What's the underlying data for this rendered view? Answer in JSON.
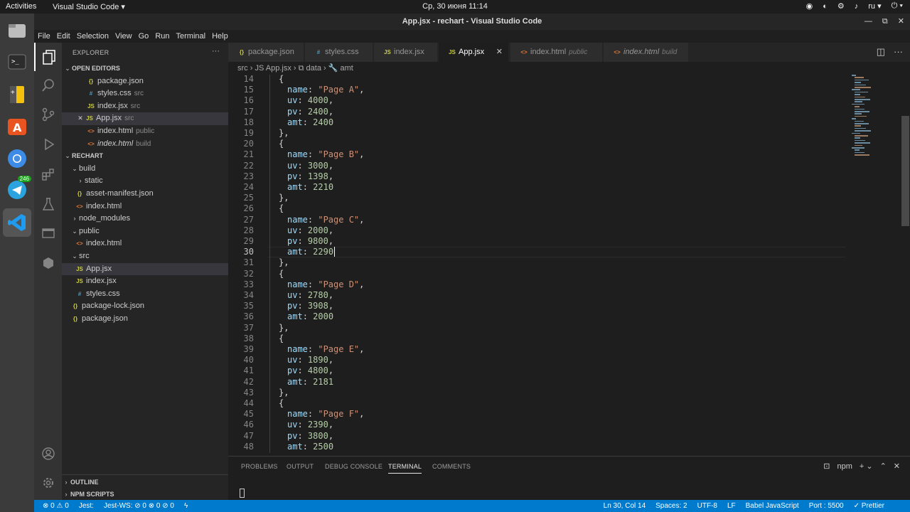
{
  "os": {
    "activities": "Activities",
    "app_menu": "Visual Studio Code ▾",
    "clock": "Ср, 30 июня  11:14",
    "lang": "ru ▾",
    "dock_badge": "246"
  },
  "window": {
    "title": "App.jsx - rechart - Visual Studio Code"
  },
  "menu": [
    "File",
    "Edit",
    "Selection",
    "View",
    "Go",
    "Run",
    "Terminal",
    "Help"
  ],
  "explorer": {
    "title": "EXPLORER",
    "open_editors": {
      "header": "OPEN EDITORS",
      "items": [
        {
          "icon": "{}",
          "cls": "json",
          "name": "package.json",
          "desc": ""
        },
        {
          "icon": "#",
          "cls": "css",
          "name": "styles.css",
          "desc": "src"
        },
        {
          "icon": "JS",
          "cls": "js",
          "name": "index.jsx",
          "desc": "src"
        },
        {
          "icon": "JS",
          "cls": "js",
          "name": "App.jsx",
          "desc": "src"
        },
        {
          "icon": "<>",
          "cls": "html",
          "name": "index.html",
          "desc": "public"
        },
        {
          "icon": "<>",
          "cls": "html",
          "name": "index.html",
          "desc": "build"
        }
      ]
    },
    "project": {
      "header": "RECHART",
      "items": [
        {
          "chev": "⌄",
          "name": "build"
        },
        {
          "chev": "›",
          "name": "static"
        },
        {
          "icon": "{}",
          "cls": "json",
          "name": "asset-manifest.json"
        },
        {
          "icon": "<>",
          "cls": "html",
          "name": "index.html"
        },
        {
          "chev": "›",
          "name": "node_modules"
        },
        {
          "chev": "⌄",
          "name": "public"
        },
        {
          "icon": "<>",
          "cls": "html",
          "name": "index.html"
        },
        {
          "chev": "⌄",
          "name": "src"
        },
        {
          "icon": "JS",
          "cls": "js",
          "name": "App.jsx"
        },
        {
          "icon": "JS",
          "cls": "js",
          "name": "index.jsx"
        },
        {
          "icon": "#",
          "cls": "css",
          "name": "styles.css"
        },
        {
          "icon": "{}",
          "cls": "json",
          "name": "package-lock.json"
        },
        {
          "icon": "{}",
          "cls": "json",
          "name": "package.json"
        }
      ]
    },
    "outline": "OUTLINE",
    "npm": "NPM SCRIPTS"
  },
  "tabs": [
    {
      "icon": "{}",
      "cls": "json",
      "name": "package.json",
      "desc": ""
    },
    {
      "icon": "#",
      "cls": "css",
      "name": "styles.css",
      "desc": ""
    },
    {
      "icon": "JS",
      "cls": "js",
      "name": "index.jsx",
      "desc": ""
    },
    {
      "icon": "JS",
      "cls": "js",
      "name": "App.jsx",
      "desc": ""
    },
    {
      "icon": "<>",
      "cls": "html",
      "name": "index.html",
      "desc": "public"
    },
    {
      "icon": "<>",
      "cls": "html",
      "name": "index.html",
      "desc": "build"
    }
  ],
  "breadcrumb": [
    "src",
    "App.jsx",
    "data",
    "amt"
  ],
  "code": [
    {
      "n": 14,
      "t": [
        [
          "p",
          "{"
        ]
      ]
    },
    {
      "n": 15,
      "t": [
        [
          "k",
          "name"
        ],
        [
          "p",
          ": "
        ],
        [
          "s",
          "\"Page A\""
        ],
        [
          "p",
          ","
        ]
      ]
    },
    {
      "n": 16,
      "t": [
        [
          "k",
          "uv"
        ],
        [
          "p",
          ": "
        ],
        [
          "n",
          "4000"
        ],
        [
          "p",
          ","
        ]
      ]
    },
    {
      "n": 17,
      "t": [
        [
          "k",
          "pv"
        ],
        [
          "p",
          ": "
        ],
        [
          "n",
          "2400"
        ],
        [
          "p",
          ","
        ]
      ]
    },
    {
      "n": 18,
      "t": [
        [
          "k",
          "amt"
        ],
        [
          "p",
          ": "
        ],
        [
          "n",
          "2400"
        ]
      ]
    },
    {
      "n": 19,
      "t": [
        [
          "p",
          "},"
        ]
      ]
    },
    {
      "n": 20,
      "t": [
        [
          "p",
          "{"
        ]
      ]
    },
    {
      "n": 21,
      "t": [
        [
          "k",
          "name"
        ],
        [
          "p",
          ": "
        ],
        [
          "s",
          "\"Page B\""
        ],
        [
          "p",
          ","
        ]
      ]
    },
    {
      "n": 22,
      "t": [
        [
          "k",
          "uv"
        ],
        [
          "p",
          ": "
        ],
        [
          "n",
          "3000"
        ],
        [
          "p",
          ","
        ]
      ]
    },
    {
      "n": 23,
      "t": [
        [
          "k",
          "pv"
        ],
        [
          "p",
          ": "
        ],
        [
          "n",
          "1398"
        ],
        [
          "p",
          ","
        ]
      ]
    },
    {
      "n": 24,
      "t": [
        [
          "k",
          "amt"
        ],
        [
          "p",
          ": "
        ],
        [
          "n",
          "2210"
        ]
      ]
    },
    {
      "n": 25,
      "t": [
        [
          "p",
          "},"
        ]
      ]
    },
    {
      "n": 26,
      "t": [
        [
          "p",
          "{"
        ]
      ]
    },
    {
      "n": 27,
      "t": [
        [
          "k",
          "name"
        ],
        [
          "p",
          ": "
        ],
        [
          "s",
          "\"Page C\""
        ],
        [
          "p",
          ","
        ]
      ]
    },
    {
      "n": 28,
      "t": [
        [
          "k",
          "uv"
        ],
        [
          "p",
          ": "
        ],
        [
          "n",
          "2000"
        ],
        [
          "p",
          ","
        ]
      ]
    },
    {
      "n": 29,
      "t": [
        [
          "k",
          "pv"
        ],
        [
          "p",
          ": "
        ],
        [
          "n",
          "9800"
        ],
        [
          "p",
          ","
        ]
      ]
    },
    {
      "n": 30,
      "t": [
        [
          "k",
          "amt"
        ],
        [
          "p",
          ": "
        ],
        [
          "n",
          "2290"
        ]
      ]
    },
    {
      "n": 31,
      "t": [
        [
          "p",
          "},"
        ]
      ]
    },
    {
      "n": 32,
      "t": [
        [
          "p",
          "{"
        ]
      ]
    },
    {
      "n": 33,
      "t": [
        [
          "k",
          "name"
        ],
        [
          "p",
          ": "
        ],
        [
          "s",
          "\"Page D\""
        ],
        [
          "p",
          ","
        ]
      ]
    },
    {
      "n": 34,
      "t": [
        [
          "k",
          "uv"
        ],
        [
          "p",
          ": "
        ],
        [
          "n",
          "2780"
        ],
        [
          "p",
          ","
        ]
      ]
    },
    {
      "n": 35,
      "t": [
        [
          "k",
          "pv"
        ],
        [
          "p",
          ": "
        ],
        [
          "n",
          "3908"
        ],
        [
          "p",
          ","
        ]
      ]
    },
    {
      "n": 36,
      "t": [
        [
          "k",
          "amt"
        ],
        [
          "p",
          ": "
        ],
        [
          "n",
          "2000"
        ]
      ]
    },
    {
      "n": 37,
      "t": [
        [
          "p",
          "},"
        ]
      ]
    },
    {
      "n": 38,
      "t": [
        [
          "p",
          "{"
        ]
      ]
    },
    {
      "n": 39,
      "t": [
        [
          "k",
          "name"
        ],
        [
          "p",
          ": "
        ],
        [
          "s",
          "\"Page E\""
        ],
        [
          "p",
          ","
        ]
      ]
    },
    {
      "n": 40,
      "t": [
        [
          "k",
          "uv"
        ],
        [
          "p",
          ": "
        ],
        [
          "n",
          "1890"
        ],
        [
          "p",
          ","
        ]
      ]
    },
    {
      "n": 41,
      "t": [
        [
          "k",
          "pv"
        ],
        [
          "p",
          ": "
        ],
        [
          "n",
          "4800"
        ],
        [
          "p",
          ","
        ]
      ]
    },
    {
      "n": 42,
      "t": [
        [
          "k",
          "amt"
        ],
        [
          "p",
          ": "
        ],
        [
          "n",
          "2181"
        ]
      ]
    },
    {
      "n": 43,
      "t": [
        [
          "p",
          "},"
        ]
      ]
    },
    {
      "n": 44,
      "t": [
        [
          "p",
          "{"
        ]
      ]
    },
    {
      "n": 45,
      "t": [
        [
          "k",
          "name"
        ],
        [
          "p",
          ": "
        ],
        [
          "s",
          "\"Page F\""
        ],
        [
          "p",
          ","
        ]
      ]
    },
    {
      "n": 46,
      "t": [
        [
          "k",
          "uv"
        ],
        [
          "p",
          ": "
        ],
        [
          "n",
          "2390"
        ],
        [
          "p",
          ","
        ]
      ]
    },
    {
      "n": 47,
      "t": [
        [
          "k",
          "pv"
        ],
        [
          "p",
          ": "
        ],
        [
          "n",
          "3800"
        ],
        [
          "p",
          ","
        ]
      ]
    },
    {
      "n": 48,
      "t": [
        [
          "k",
          "amt"
        ],
        [
          "p",
          ": "
        ],
        [
          "n",
          "2500"
        ]
      ]
    }
  ],
  "current_line": 30,
  "panel": {
    "tabs": [
      "PROBLEMS",
      "OUTPUT",
      "DEBUG CONSOLE",
      "TERMINAL",
      "COMMENTS"
    ],
    "active": "TERMINAL",
    "terminal_name": "npm"
  },
  "status": {
    "errors": "⊗ 0 ⚠ 0",
    "jest": "Jest:",
    "jest_ws": "Jest-WS: ⊘ 0 ⊗ 0 ⊘ 0",
    "position": "Ln 30, Col 14",
    "spaces": "Spaces: 2",
    "encoding": "UTF-8",
    "eol": "LF",
    "language": "Babel JavaScript",
    "port": "Port : 5500",
    "prettier": "✓ Prettier"
  },
  "colors": {
    "accent": "#007acc",
    "string": "#ce9178",
    "key": "#9cdcfe",
    "number": "#b5cea8"
  }
}
